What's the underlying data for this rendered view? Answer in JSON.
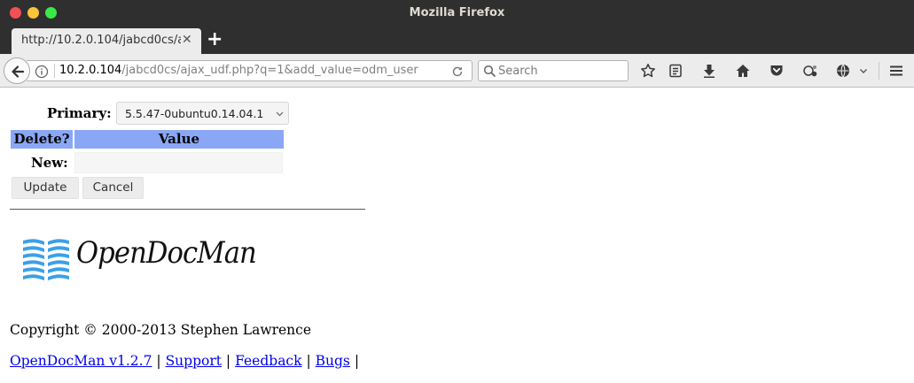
{
  "window": {
    "title": "Mozilla Firefox"
  },
  "tab": {
    "title": "http://10.2.0.104/jabcd0cs/ajax_udf.php?q=1&add_value=odm_user"
  },
  "navbar": {
    "url_host": "10.2.0.104",
    "url_path": "/jabcd0cs/ajax_udf.php?q=1&add_value=odm_user",
    "search_placeholder": "Search"
  },
  "form": {
    "primary_label": "Primary:",
    "primary_value": "5.5.47-0ubuntu0.14.04.1",
    "col_delete": "Delete?",
    "col_value": "Value",
    "new_label": "New:",
    "new_value": "",
    "update_label": "Update",
    "cancel_label": "Cancel"
  },
  "logo": {
    "text": "OpenDocMan"
  },
  "footer": {
    "copyright": "Copyright © 2000-2013 Stephen Lawrence",
    "links": [
      "OpenDocMan v1.2.7",
      "Support",
      "Feedback",
      "Bugs"
    ],
    "separator": "|"
  },
  "colors": {
    "header_blue": "#8aa7f5",
    "link_blue": "#0000ee",
    "logo_blue": "#3aa0e8"
  }
}
